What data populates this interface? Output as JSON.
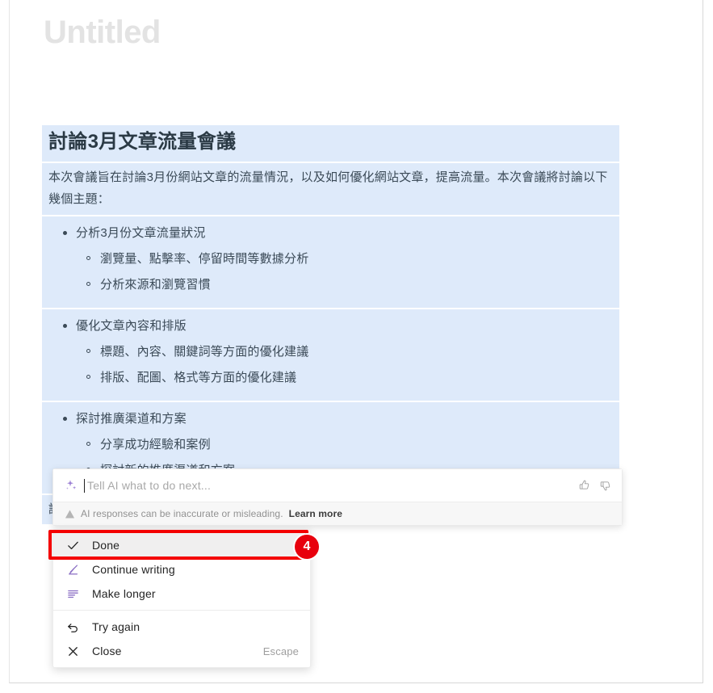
{
  "document": {
    "title_placeholder": "Untitled",
    "heading": "討論3月文章流量會議",
    "intro": "本次會議旨在討論3月份網站文章的流量情況，以及如何優化網站文章，提高流量。本次會議將討論以下幾個主題：",
    "sections": [
      {
        "bullet": "分析3月份文章流量狀況",
        "subs": [
          "瀏覽量、點擊率、停留時間等數據分析",
          "分析來源和瀏覽習慣"
        ]
      },
      {
        "bullet": "優化文章內容和排版",
        "subs": [
          "標題、內容、關鍵詞等方面的優化建議",
          "排版、配圖、格式等方面的優化建議"
        ]
      },
      {
        "bullet": "探討推廣渠道和方案",
        "subs": [
          "分享成功經驗和案例",
          "探討新的推廣渠道和方案"
        ]
      }
    ],
    "closing": "請各位準時參加會議，準備好相關資料和意見，以便會議能夠順利進行。"
  },
  "ai_prompt": {
    "sparkle_icon": "sparkle-icon",
    "placeholder": "Tell AI what to do next...",
    "input_value": "",
    "thumbs_up_icon": "thumbs-up-icon",
    "thumbs_down_icon": "thumbs-down-icon",
    "disclaimer_icon": "warning-icon",
    "disclaimer": "AI responses can be inaccurate or misleading.",
    "learn_more": "Learn more"
  },
  "ai_menu": {
    "items": [
      {
        "label": "Done",
        "icon": "check-icon",
        "shortcut": "",
        "selected": true
      },
      {
        "label": "Continue writing",
        "icon": "pencil-icon",
        "shortcut": "",
        "selected": false
      },
      {
        "label": "Make longer",
        "icon": "text-lines-icon",
        "shortcut": "",
        "selected": false
      }
    ],
    "items_secondary": [
      {
        "label": "Try again",
        "icon": "undo-icon",
        "shortcut": "",
        "selected": false
      },
      {
        "label": "Close",
        "icon": "close-icon",
        "shortcut": "Escape",
        "selected": false
      }
    ]
  },
  "annotation": {
    "step_number": "4",
    "color": "#e8000d"
  },
  "colors": {
    "highlight_blue": "#deeafa",
    "text": "#3b4a57",
    "accent_purple": "#8b6fc4",
    "annotation_red": "#e8000d"
  }
}
